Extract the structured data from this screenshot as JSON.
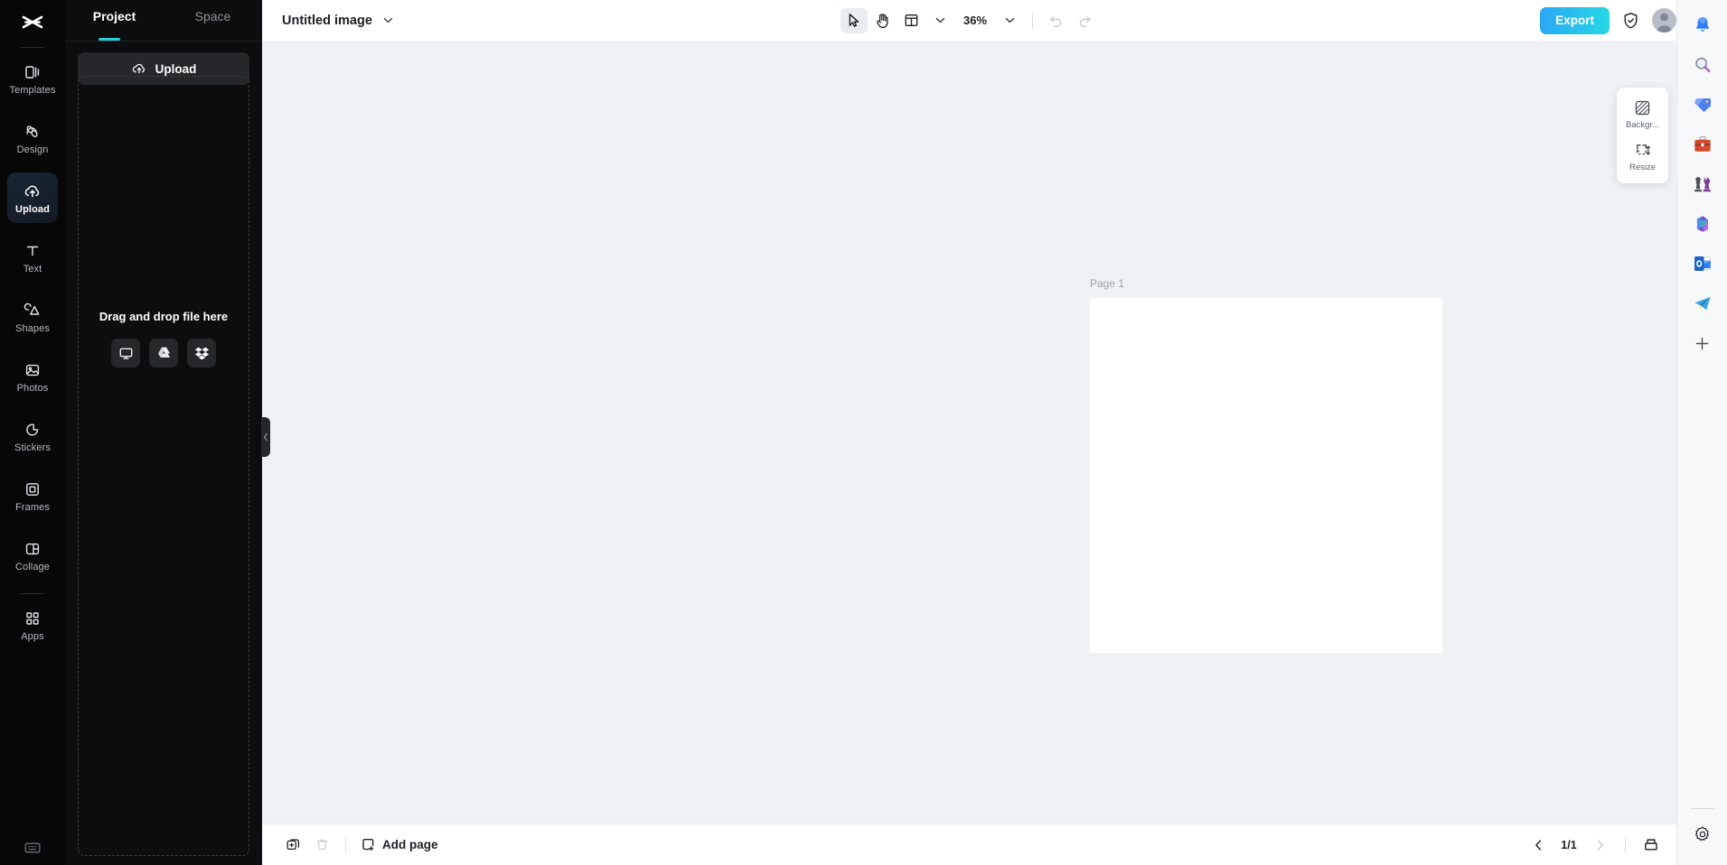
{
  "app": {
    "brand": "capcut-logo"
  },
  "rail": {
    "items": [
      {
        "label": "Templates",
        "icon": "templates-icon",
        "active": false
      },
      {
        "label": "Design",
        "icon": "design-icon",
        "active": false
      },
      {
        "label": "Upload",
        "icon": "upload-cloud-icon",
        "active": true
      },
      {
        "label": "Text",
        "icon": "text-icon",
        "active": false
      },
      {
        "label": "Shapes",
        "icon": "shapes-icon",
        "active": false
      },
      {
        "label": "Photos",
        "icon": "photos-icon",
        "active": false
      },
      {
        "label": "Stickers",
        "icon": "stickers-icon",
        "active": false
      },
      {
        "label": "Frames",
        "icon": "frames-icon",
        "active": false
      },
      {
        "label": "Collage",
        "icon": "collage-icon",
        "active": false
      },
      {
        "label": "Apps",
        "icon": "apps-icon",
        "active": false
      }
    ],
    "bottom_icon": "keyboard-shortcuts-icon",
    "active_accent": "#25d0d8"
  },
  "panel": {
    "tabs": [
      {
        "label": "Project",
        "active": true
      },
      {
        "label": "Space",
        "active": false
      }
    ],
    "upload_label": "Upload",
    "dropzone_text": "Drag and drop file here",
    "sources": [
      {
        "name": "this-device",
        "icon": "monitor-icon"
      },
      {
        "name": "google-drive",
        "icon": "google-drive-icon"
      },
      {
        "name": "dropbox",
        "icon": "dropbox-icon"
      }
    ],
    "collapse_icon": "chevron-left-icon"
  },
  "topbar": {
    "doc_title": "Untitled image",
    "title_caret": "chevron-down-icon",
    "tools": [
      {
        "name": "select-tool",
        "icon": "cursor-arrow-icon",
        "selected": true
      },
      {
        "name": "hand-tool",
        "icon": "hand-icon",
        "selected": false
      },
      {
        "name": "layout-tool",
        "icon": "layout-grid-icon",
        "selected": false
      },
      {
        "name": "layout-caret",
        "icon": "chevron-down-icon",
        "selected": false
      }
    ],
    "zoom_level": "36%",
    "zoom_caret": "chevron-down-icon",
    "undo": {
      "name": "undo-button",
      "icon": "undo-icon",
      "disabled": true
    },
    "redo": {
      "name": "redo-button",
      "icon": "redo-icon",
      "disabled": true
    },
    "export_label": "Export",
    "shield_icon": "shield-check-icon",
    "avatar": "user-avatar",
    "export_gradient_from": "#2aa7f5",
    "export_gradient_to": "#26d8e4"
  },
  "canvas": {
    "page_label": "Page 1",
    "background": "#eff2f5",
    "sheet_color": "#ffffff"
  },
  "float_card": {
    "items": [
      {
        "label": "Backgr...",
        "icon": "background-pattern-icon"
      },
      {
        "label": "Resize",
        "icon": "resize-icon"
      }
    ]
  },
  "bottombar": {
    "duplicate": {
      "name": "duplicate-page-button",
      "icon": "duplicate-icon"
    },
    "delete": {
      "name": "delete-page-button",
      "icon": "trash-icon",
      "disabled": true
    },
    "add_page_label": "Add page",
    "add_page_icon": "add-page-icon",
    "prev": {
      "name": "prev-page-button",
      "icon": "chevron-left-icon"
    },
    "next": {
      "name": "next-page-button",
      "icon": "chevron-right-icon",
      "disabled": true
    },
    "page_indicator": "1/1",
    "grid_view": {
      "name": "pages-grid-button",
      "icon": "pages-grid-icon"
    }
  },
  "dock": {
    "items": [
      {
        "name": "notifications",
        "icon": "bell-icon"
      },
      {
        "name": "search",
        "icon": "magnifier-icon"
      },
      {
        "name": "labels",
        "icon": "tag-icon"
      },
      {
        "name": "work",
        "icon": "briefcase-icon"
      },
      {
        "name": "chess",
        "icon": "chess-icon"
      },
      {
        "name": "microsoft-365",
        "icon": "microsoft-365-icon"
      },
      {
        "name": "outlook",
        "icon": "outlook-icon"
      },
      {
        "name": "telegram",
        "icon": "telegram-icon"
      }
    ],
    "add_label": "+",
    "settings_icon": "gear-icon"
  }
}
